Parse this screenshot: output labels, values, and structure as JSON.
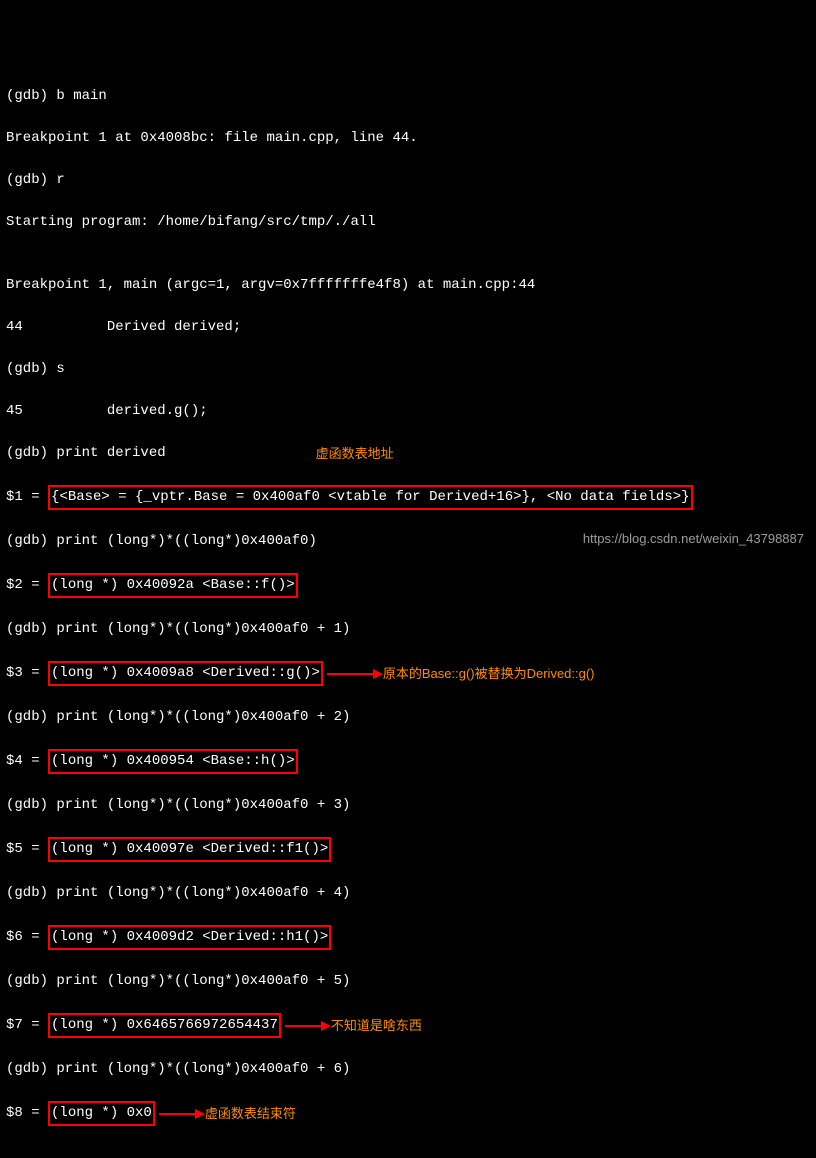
{
  "l1": "(gdb) b main",
  "l2": "Breakpoint 1 at 0x4008bc: file main.cpp, line 44.",
  "l3": "(gdb) r",
  "l4": "Starting program: /home/bifang/src/tmp/./all",
  "l5": "",
  "l6": "Breakpoint 1, main (argc=1, argv=0x7fffffffe4f8) at main.cpp:44",
  "l7": "44          Derived derived;",
  "l8": "(gdb) s",
  "l9": "45          derived.g();",
  "l10": "(gdb) print derived",
  "d1p": "$1 = ",
  "d1b": "{<Base> = {_vptr.Base = 0x400af0 <vtable for Derived+16>}, <No data fields>}",
  "l12": "(gdb) print (long*)*((long*)0x400af0)",
  "d2p": "$2 = ",
  "d2b": "(long *) 0x40092a <Base::f()>",
  "l14": "(gdb) print (long*)*((long*)0x400af0 + 1)",
  "d3p": "$3 = ",
  "d3b": "(long *) 0x4009a8 <Derived::g()>",
  "l16": "(gdb) print (long*)*((long*)0x400af0 + 2)",
  "d4p": "$4 = ",
  "d4b": "(long *) 0x400954 <Base::h()>",
  "l18": "(gdb) print (long*)*((long*)0x400af0 + 3)",
  "d5p": "$5 = ",
  "d5b": "(long *) 0x40097e <Derived::f1()>",
  "l20": "(gdb) print (long*)*((long*)0x400af0 + 4)",
  "d6p": "$6 = ",
  "d6b": "(long *) 0x4009d2 <Derived::h1()>",
  "l22": "(gdb) print (long*)*((long*)0x400af0 + 5)",
  "d7p": "$7 = ",
  "d7b": "(long *) 0x6465766972654437",
  "l24": "(gdb) print (long*)*((long*)0x400af0 + 6)",
  "d8p": "$8 = ",
  "d8b": "(long *) 0x0",
  "a1": "虚函数表地址",
  "a3": "原本的Base::g()被替换为Derived::g()",
  "a7": "不知道是啥东西",
  "a8": "虚函数表结束符",
  "wm": "https://blog.csdn.net/weixin_43798887"
}
